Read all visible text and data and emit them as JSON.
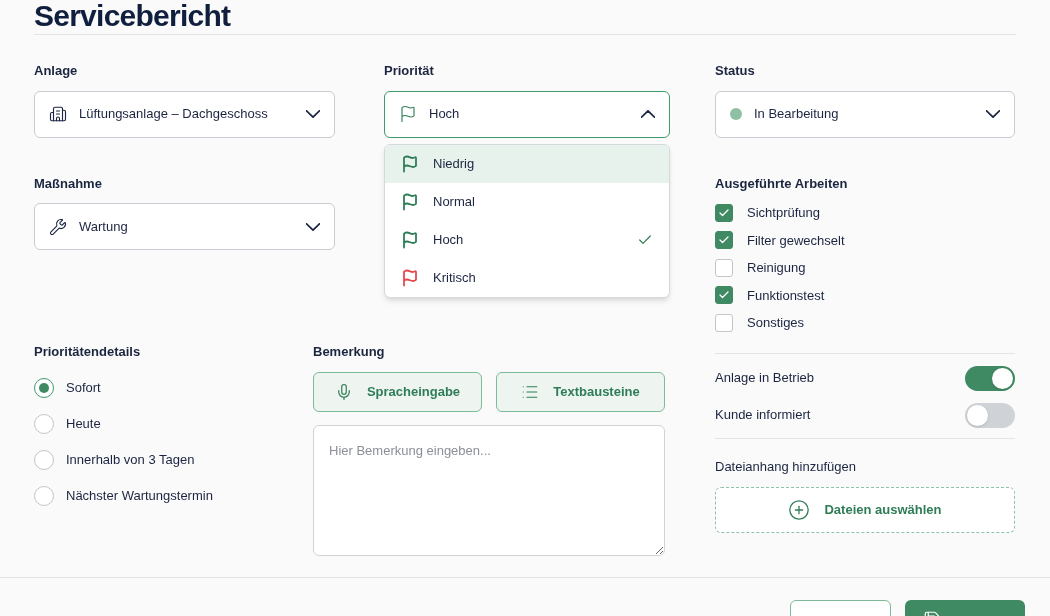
{
  "title": "Servicebericht",
  "anlage": {
    "label": "Anlage",
    "value": "Lüftungsanlage – Dachgeschoss"
  },
  "prioritaet": {
    "label": "Priorität",
    "value": "Hoch",
    "expanded": true,
    "options": [
      {
        "label": "Niedrig",
        "color": "#2f7d57",
        "highlighted": true,
        "selected": false
      },
      {
        "label": "Normal",
        "color": "#2f7d57",
        "highlighted": false,
        "selected": false
      },
      {
        "label": "Hoch",
        "color": "#2f7d57",
        "highlighted": false,
        "selected": true
      },
      {
        "label": "Kritisch",
        "color": "#e5484d",
        "highlighted": false,
        "selected": false
      }
    ]
  },
  "status": {
    "label": "Status",
    "value": "In Bearbeitung",
    "color": "#8fbfa5"
  },
  "massnahme": {
    "label": "Maßnahme",
    "value": "Wartung"
  },
  "arbeiten": {
    "label": "Ausgeführte Arbeiten",
    "items": [
      {
        "label": "Sichtprüfung",
        "checked": true
      },
      {
        "label": "Filter gewechselt",
        "checked": true
      },
      {
        "label": "Reinigung",
        "checked": false
      },
      {
        "label": "Funktionstest",
        "checked": true
      },
      {
        "label": "Sonstiges",
        "checked": false
      }
    ]
  },
  "toggles": [
    {
      "label": "Anlage in Betrieb",
      "on": true
    },
    {
      "label": "Kunde informiert",
      "on": false
    }
  ],
  "anhang": {
    "label": "Dateianhang hinzufügen",
    "button": "Dateien auswählen"
  },
  "details": {
    "label": "Prioritätendetails",
    "options": [
      {
        "label": "Sofort",
        "selected": true
      },
      {
        "label": "Heute",
        "selected": false
      },
      {
        "label": "Innerhalb von 3 Tagen",
        "selected": false
      },
      {
        "label": "Nächster Wartungstermin",
        "selected": false
      }
    ]
  },
  "bemerkung": {
    "label": "Bemerkung",
    "buttons": [
      {
        "kind": "mic",
        "label": "Spracheingabe"
      },
      {
        "kind": "list",
        "label": "Textbausteine"
      }
    ],
    "placeholder": "Hier Bemerkung eingeben..."
  },
  "footer_buttons": [
    {
      "kind": "secondary"
    },
    {
      "kind": "primary"
    }
  ]
}
